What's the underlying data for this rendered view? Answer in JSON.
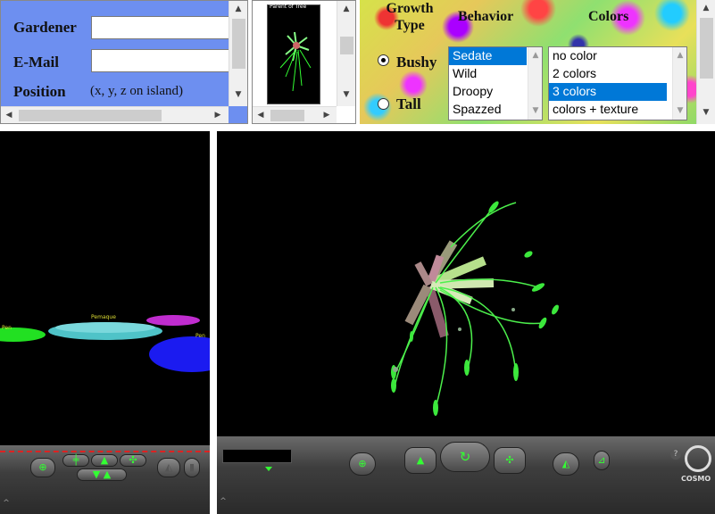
{
  "form": {
    "gardener_label": "Gardener",
    "gardener_value": "",
    "email_label": "E-Mail",
    "email_value": "",
    "position_label": "Position",
    "position_hint": "(x, y, z on island)"
  },
  "thumbnail": {
    "caption": "Parent of Tree"
  },
  "options": {
    "growth_type_label_1": "Growth",
    "growth_type_label_2": "Type",
    "behavior_label": "Behavior",
    "colors_label": "Colors",
    "growth_types": [
      {
        "label": "Bushy",
        "selected": true
      },
      {
        "label": "Tall",
        "selected": false
      }
    ],
    "behaviors": [
      {
        "label": "Sedate",
        "selected": true
      },
      {
        "label": "Wild",
        "selected": false
      },
      {
        "label": "Droopy",
        "selected": false
      },
      {
        "label": "Spazzed",
        "selected": false
      }
    ],
    "color_modes": [
      {
        "label": "no color",
        "selected": false
      },
      {
        "label": "2 colors",
        "selected": false
      },
      {
        "label": "3 colors",
        "selected": true
      },
      {
        "label": "colors + texture",
        "selected": false
      }
    ]
  },
  "scene_left": {
    "island_labels": [
      "Pen",
      "Pemaque",
      "Pen"
    ]
  },
  "cosmo": {
    "brand": "COSMO"
  },
  "colors": {
    "form_bg": "#6d8ff0",
    "scene_bg": "#000000",
    "accent_green": "#33ff33",
    "select_blue": "#0078d7"
  }
}
